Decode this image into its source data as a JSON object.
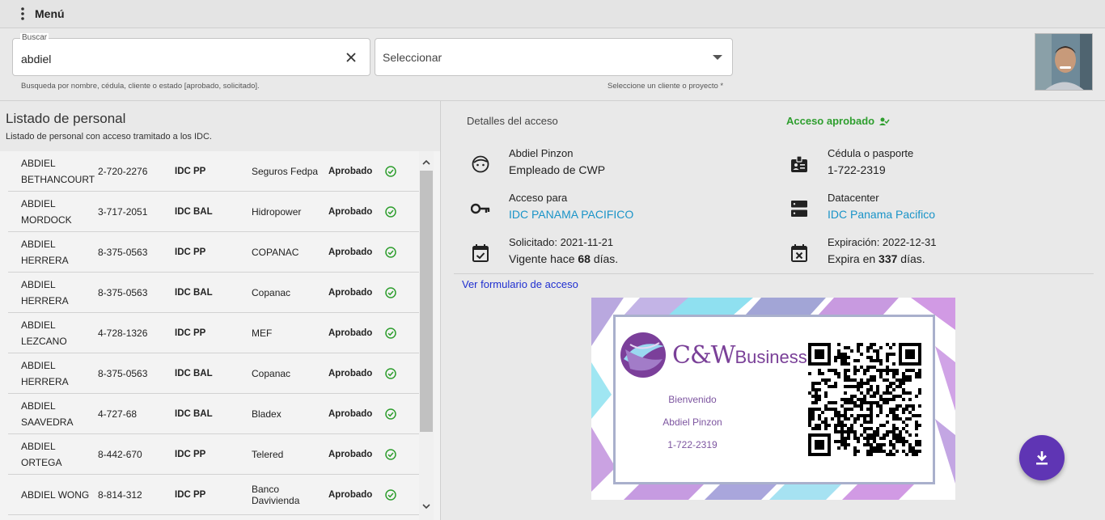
{
  "topbar": {
    "menu_label": "Menú"
  },
  "filters": {
    "search_label": "Buscar",
    "search_value": "abdiel",
    "search_helper": "Busqueda por nombre, cédula, cliente o estado [aprobado, solicitado].",
    "select_placeholder": "Seleccionar",
    "select_helper": "Seleccione un cliente o proyecto *"
  },
  "list": {
    "title": "Listado de personal",
    "subtitle": "Listado de personal con acceso tramitado a los IDC.",
    "rows": [
      {
        "name": "ABDIEL BETHANCOURT",
        "ced": "2-720-2276",
        "idc": "IDC PP",
        "client": "Seguros Fedpa",
        "status": "Aprobado"
      },
      {
        "name": "ABDIEL MORDOCK",
        "ced": "3-717-2051",
        "idc": "IDC BAL",
        "client": "Hidropower",
        "status": "Aprobado"
      },
      {
        "name": "ABDIEL HERRERA",
        "ced": "8-375-0563",
        "idc": "IDC PP",
        "client": "COPANAC",
        "status": "Aprobado"
      },
      {
        "name": "ABDIEL HERRERA",
        "ced": "8-375-0563",
        "idc": "IDC BAL",
        "client": "Copanac",
        "status": "Aprobado"
      },
      {
        "name": "ABDIEL LEZCANO",
        "ced": "4-728-1326",
        "idc": "IDC PP",
        "client": "MEF",
        "status": "Aprobado"
      },
      {
        "name": "ABDIEL HERRERA",
        "ced": "8-375-0563",
        "idc": "IDC BAL",
        "client": "Copanac",
        "status": "Aprobado"
      },
      {
        "name": "ABDIEL SAAVEDRA",
        "ced": "4-727-68",
        "idc": "IDC BAL",
        "client": "Bladex",
        "status": "Aprobado"
      },
      {
        "name": "ABDIEL ORTEGA",
        "ced": "8-442-670",
        "idc": "IDC PP",
        "client": "Telered",
        "status": "Aprobado"
      },
      {
        "name": "ABDIEL WONG",
        "ced": "8-814-312",
        "idc": "IDC PP",
        "client": "Banco Davivienda",
        "status": "Aprobado"
      }
    ]
  },
  "details": {
    "title": "Detalles del acceso",
    "status": "Acceso aprobado",
    "person_name": "Abdiel Pinzon",
    "person_role": "Empleado de CWP",
    "id_label": "Cédula o pasporte",
    "id_value": "1-722-2319",
    "access_label": "Acceso para",
    "access_value": "IDC PANAMA PACIFICO",
    "dc_label": "Datacenter",
    "dc_value": "IDC Panama Pacifico",
    "requested": "Solicitado: 2021-11-21",
    "valid_prefix": "Vigente hace ",
    "valid_days": "68",
    "valid_suffix": " días.",
    "expiration": "Expiración: 2022-12-31",
    "expires_prefix": "Expira en ",
    "expires_days": "337",
    "expires_suffix": " días.",
    "form_link": "Ver formulario de acceso"
  },
  "card": {
    "brand": "C&W",
    "brand_sub": "Business",
    "welcome": "Bienvenido",
    "name": "Abdiel Pinzon",
    "id": "1-722-2319"
  },
  "colors": {
    "accent": "#5f35b4",
    "approved": "#2e9e2e",
    "link": "#1a94c8"
  },
  "icons": [
    "menu-icon",
    "clear-icon",
    "dropdown-icon",
    "check-circle-icon",
    "face-icon",
    "badge-icon",
    "key-icon",
    "server-icon",
    "event-available-icon",
    "event-busy-icon",
    "approved-user-icon",
    "download-icon"
  ]
}
